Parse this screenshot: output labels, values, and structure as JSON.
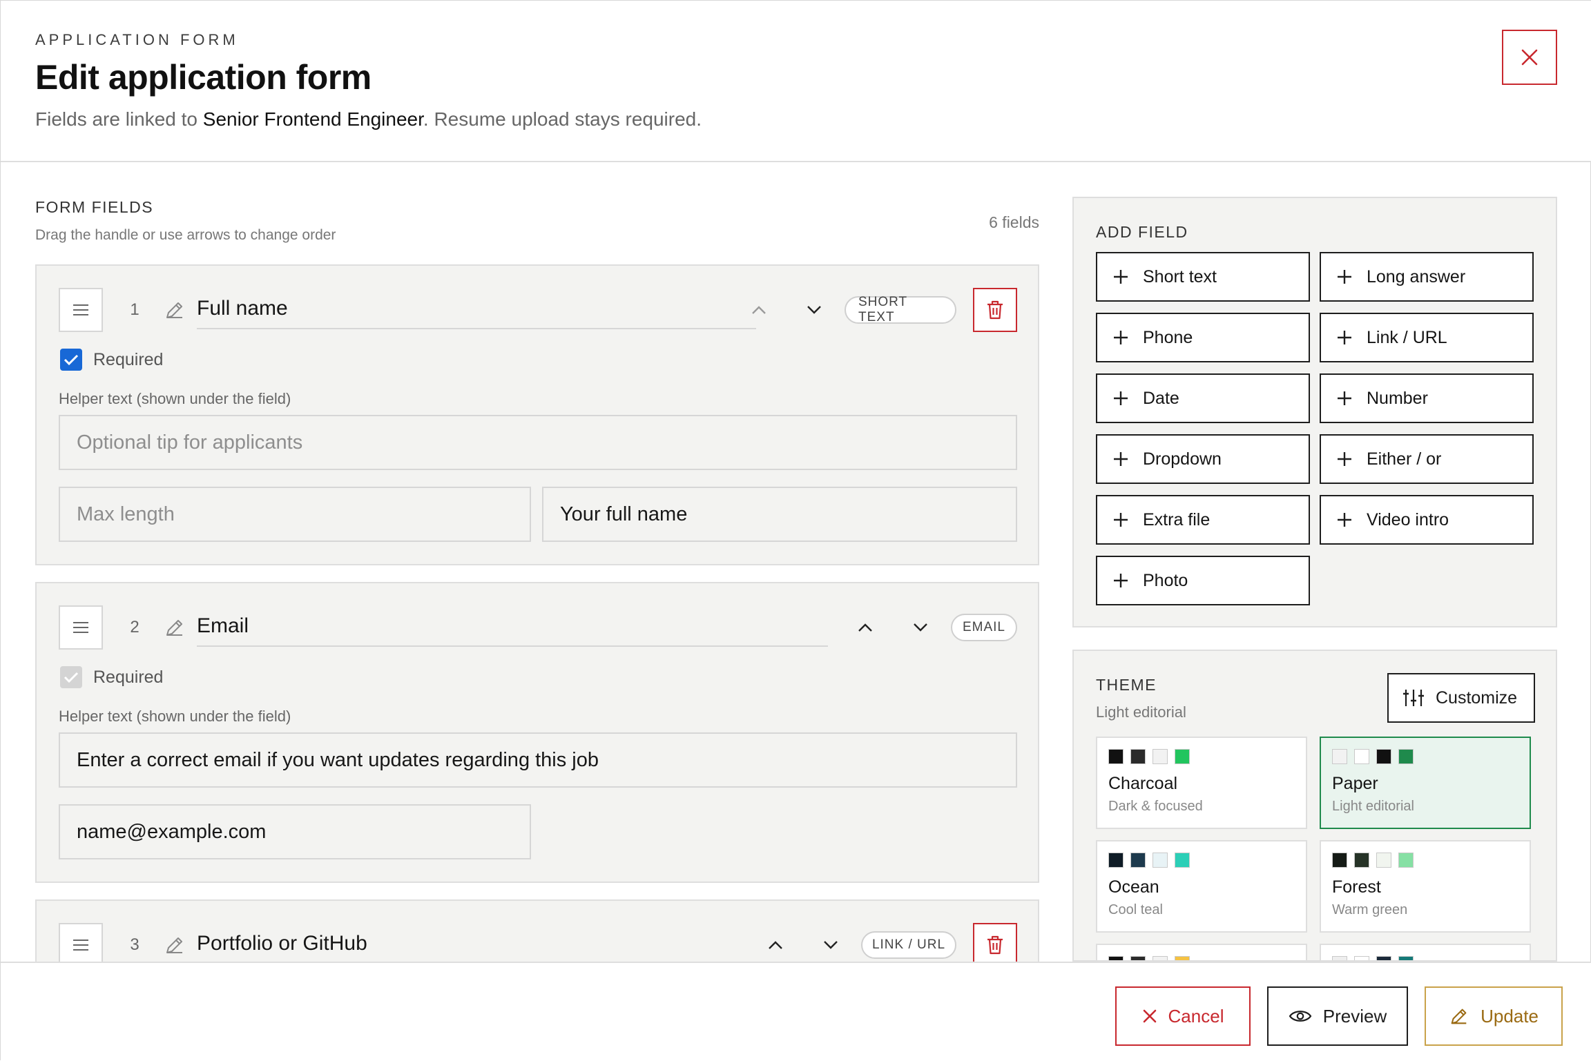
{
  "header": {
    "eyebrow": "APPLICATION FORM",
    "title": "Edit application form",
    "subtitle_prefix": "Fields are linked to ",
    "subtitle_job": "Senior Frontend Engineer",
    "subtitle_suffix": ". Resume upload stays required.",
    "close_icon": "close-icon"
  },
  "form_fields": {
    "title": "FORM FIELDS",
    "hint": "Drag the handle or use arrows to change order",
    "count": "6 fields",
    "helper_label": "Helper text (shown under the field)",
    "required_label": "Required",
    "items": [
      {
        "number": "1",
        "label": "Full name",
        "type": "SHORT TEXT",
        "required": true,
        "helper_placeholder": "Optional tip for applicants",
        "max_length_placeholder": "Max length",
        "example_value": "Your full name"
      },
      {
        "number": "2",
        "label": "Email",
        "type": "EMAIL",
        "required": true,
        "required_locked": true,
        "helper_value": "Enter a correct email if you want updates regarding this job",
        "example_value": "name@example.com"
      },
      {
        "number": "3",
        "label": "Portfolio or GitHub",
        "type": "LINK / URL"
      }
    ]
  },
  "add_field": {
    "title": "ADD FIELD",
    "buttons": [
      "Short text",
      "Long answer",
      "Phone",
      "Link / URL",
      "Date",
      "Number",
      "Dropdown",
      "Either / or",
      "Extra file",
      "Video intro",
      "Photo"
    ]
  },
  "theme": {
    "title": "THEME",
    "current": "Light editorial",
    "customize_label": "Customize",
    "options": [
      {
        "name": "Charcoal",
        "desc": "Dark & focused",
        "swatches": [
          "#111111",
          "#2b2b2b",
          "#f2f2f2",
          "#22c55e"
        ],
        "selected": false
      },
      {
        "name": "Paper",
        "desc": "Light editorial",
        "swatches": [
          "#f2f2f2",
          "#ffffff",
          "#111111",
          "#1f8a4c"
        ],
        "selected": true
      },
      {
        "name": "Ocean",
        "desc": "Cool teal",
        "swatches": [
          "#0f1c26",
          "#1d3a4d",
          "#e8f3f6",
          "#2ccfb7"
        ],
        "selected": false
      },
      {
        "name": "Forest",
        "desc": "Warm green",
        "swatches": [
          "#151b16",
          "#263327",
          "#f1f5ef",
          "#86e0a4"
        ],
        "selected": false
      },
      {
        "name": "",
        "desc": "",
        "swatches": [
          "#111111",
          "#2b2b2b",
          "#f2f2f2",
          "#f5c242"
        ],
        "selected": false
      },
      {
        "name": "",
        "desc": "",
        "swatches": [
          "#eeeeee",
          "#ffffff",
          "#1b2a3a",
          "#157a78"
        ],
        "selected": false
      }
    ]
  },
  "footer": {
    "cancel_label": "Cancel",
    "preview_label": "Preview",
    "update_label": "Update"
  },
  "colors": {
    "danger": "#c8282e",
    "checkbox_blue": "#1868d6",
    "selected_theme": "#1f8a4c",
    "update_gold": "#c9a24a"
  }
}
